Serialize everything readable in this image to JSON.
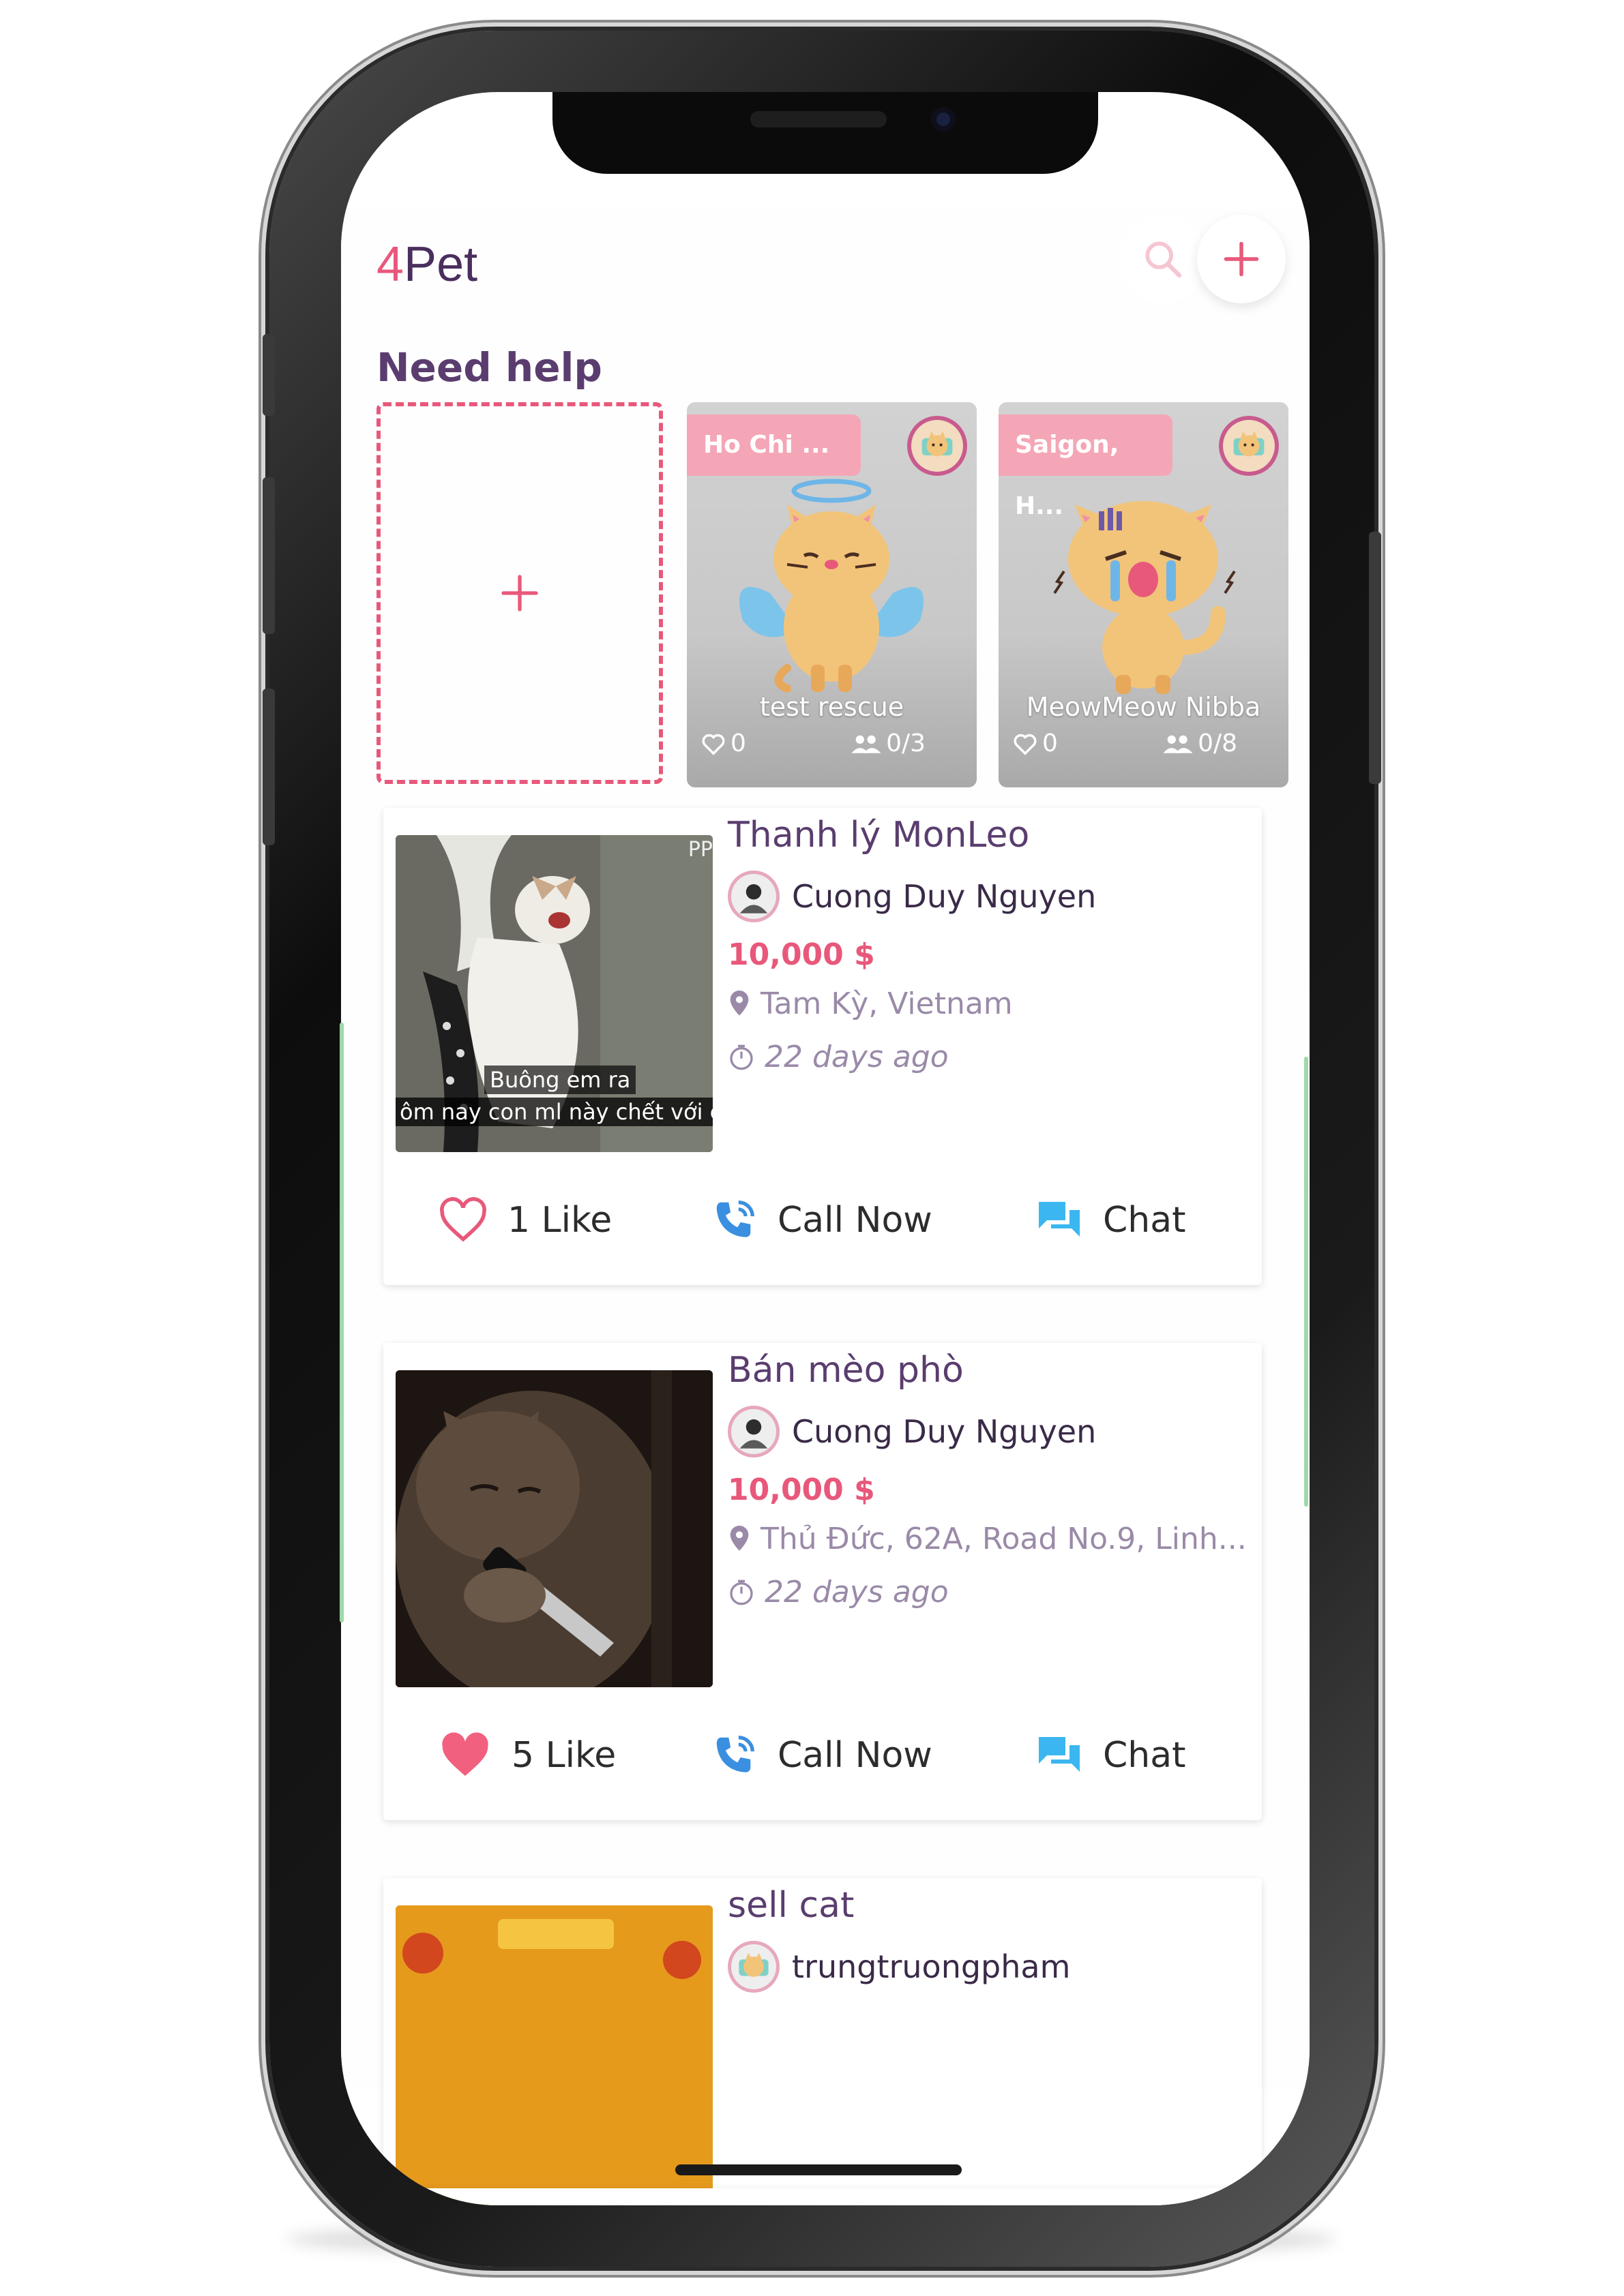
{
  "app": {
    "brand_accent": "4",
    "brand_rest": "Pet",
    "colors": {
      "primary": "#e8587a",
      "secondary": "#5a3d6e",
      "muted": "#9a8aa8",
      "chat": "#3cb6f0"
    }
  },
  "header": {
    "search_icon": "search-icon",
    "add_icon": "plus-icon"
  },
  "need_help": {
    "title": "Need help",
    "add_icon": "plus-icon",
    "cards": [
      {
        "location": "Ho Chi ...",
        "name": "test rescue",
        "likes": "0",
        "members": "0/3"
      },
      {
        "location": "Saigon, H...",
        "name": "MeowMeow Nibba",
        "likes": "0",
        "members": "0/8"
      }
    ]
  },
  "listings": [
    {
      "title": "Thanh lý MonLeo",
      "seller": "Cuong Duy Nguyen",
      "price": "10,000 $",
      "location": "Tam Kỳ, Vietnam",
      "time": "22 days ago",
      "photo_caption_1": "Buông em ra",
      "photo_caption_2": "ôm nay con ml này chết với e",
      "photo_corner": "PP",
      "like_label": "1 Like",
      "liked": false,
      "call_label": "Call Now",
      "chat_label": "Chat"
    },
    {
      "title": "Bán mèo phò",
      "seller": "Cuong Duy Nguyen",
      "price": "10,000 $",
      "location": "Thủ Đức, 62A, Road No.9, Linh...",
      "time": "22 days ago",
      "like_label": "5 Like",
      "liked": true,
      "call_label": "Call Now",
      "chat_label": "Chat"
    },
    {
      "title": "sell cat",
      "seller": "trungtruongpham"
    }
  ],
  "bottom_nav": {
    "items": [
      "home-icon",
      "bell-icon",
      "chat-bubble-icon",
      "profile-icon"
    ],
    "active": "home-icon"
  }
}
